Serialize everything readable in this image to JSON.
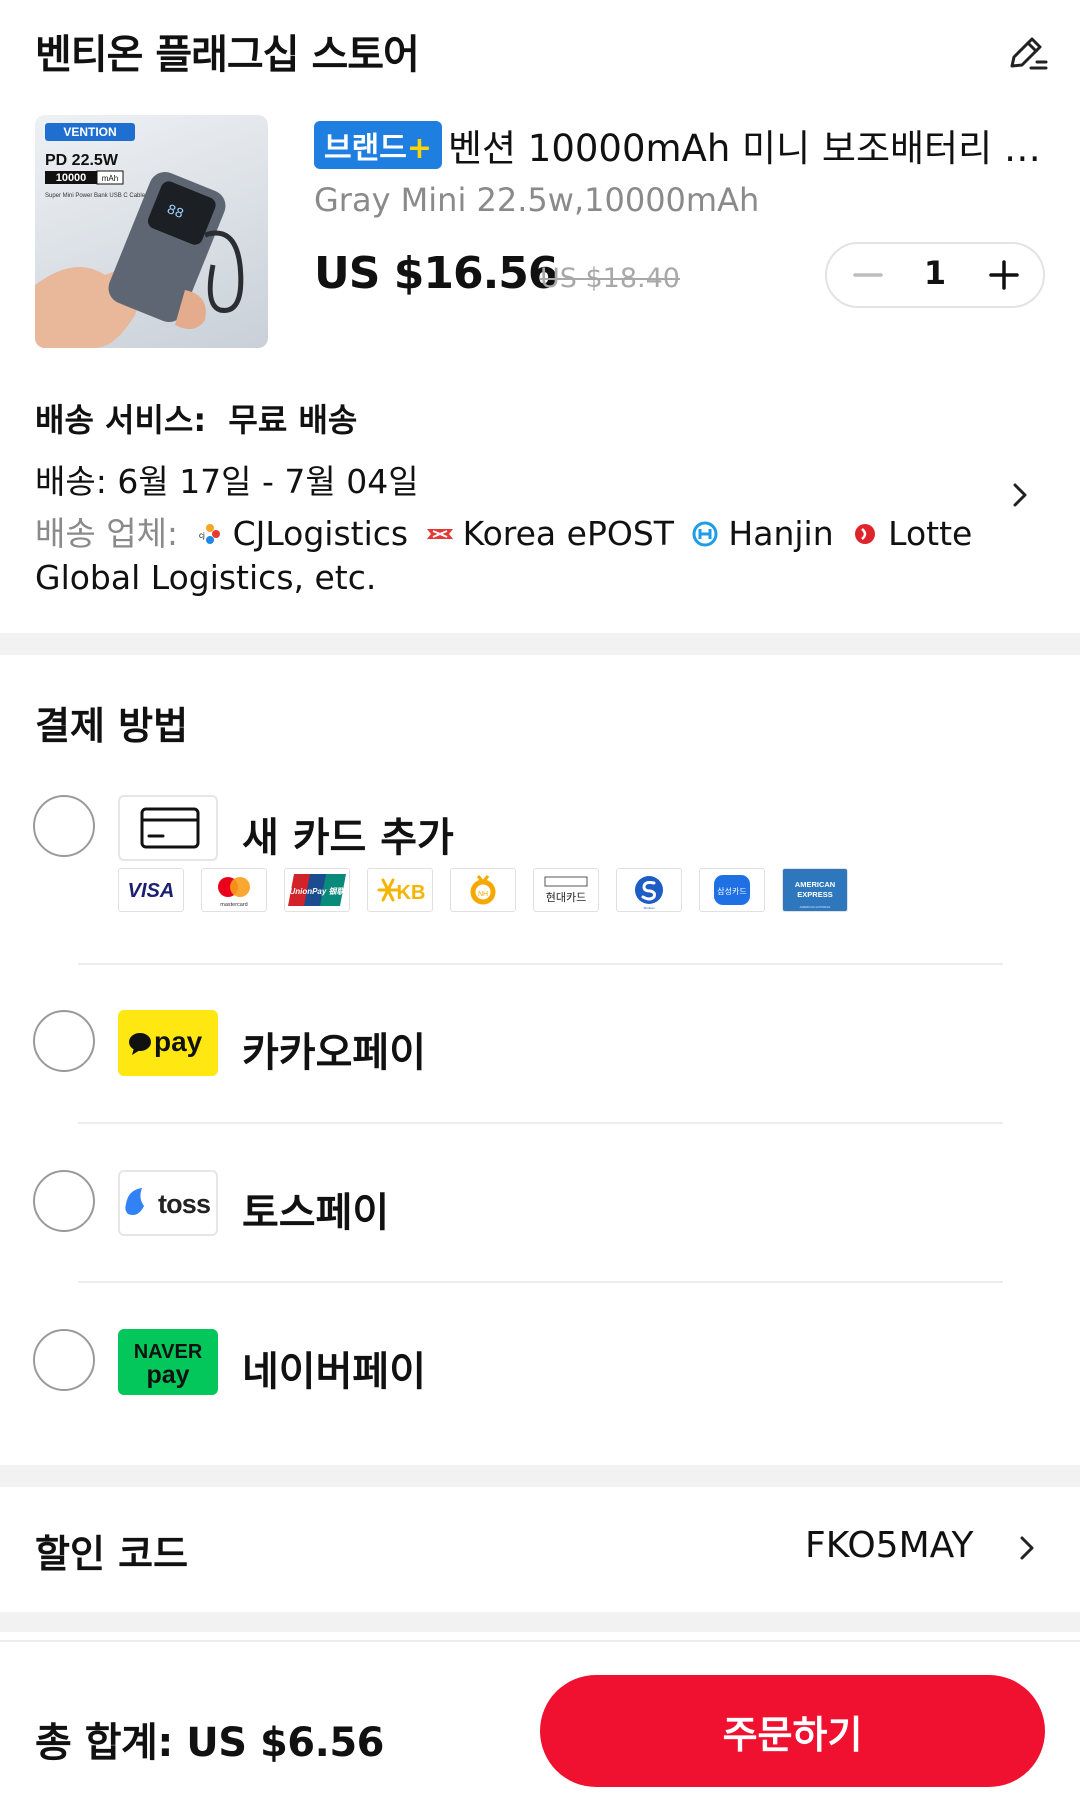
{
  "header": {
    "title": "벤티온 플래그십 스토어"
  },
  "product": {
    "image_brand": "VENTION",
    "image_spec": "PD 22.5W",
    "image_capacity": "10000",
    "image_unit": "mAh",
    "image_subtitle": "Super Mini Power Bank USB C Cable",
    "brand_badge": "브랜드",
    "brand_badge_plus": "+",
    "name": "벤션 10000mAh 미니 보조배터리 2...",
    "variant": "Gray Mini 22.5w,10000mAh",
    "price": "US $16.56",
    "original_price": "US $18.40",
    "quantity": "1"
  },
  "shipping": {
    "service_label": "배송 서비스:",
    "service_value": "무료 배송",
    "date_label": "배송:",
    "date_value": "6월 17일 - 7월 04일",
    "carriers_label": "배송 업체:",
    "carriers": [
      "CJLogistics",
      "Korea ePOST",
      "Hanjin",
      "Lotte Global Logistics, etc."
    ]
  },
  "payment": {
    "title": "결제 방법",
    "options": [
      {
        "label": "새 카드 추가",
        "icon": "credit-card-icon"
      },
      {
        "label": "카카오페이",
        "logo_text": "pay"
      },
      {
        "label": "토스페이",
        "logo_text": "toss"
      },
      {
        "label": "네이버페이",
        "logo_text_top": "NAVER",
        "logo_text_bottom": "pay"
      }
    ],
    "card_brands": [
      "VISA",
      "mastercard",
      "UnionPay 银联",
      "KB",
      "NH",
      "현대카드",
      "Shinhan",
      "삼성카드",
      "AMERICAN EXPRESS"
    ]
  },
  "discount": {
    "label": "할인 코드",
    "code": "FKO5MAY"
  },
  "footer": {
    "total": "총 합계:  US $6.56",
    "order_button": "주문하기"
  },
  "colors": {
    "accent": "#f0102f",
    "brand_badge": "#1e7fe0",
    "kakao": "#ffe812",
    "naver": "#03c75a",
    "toss": "#3182f6"
  }
}
